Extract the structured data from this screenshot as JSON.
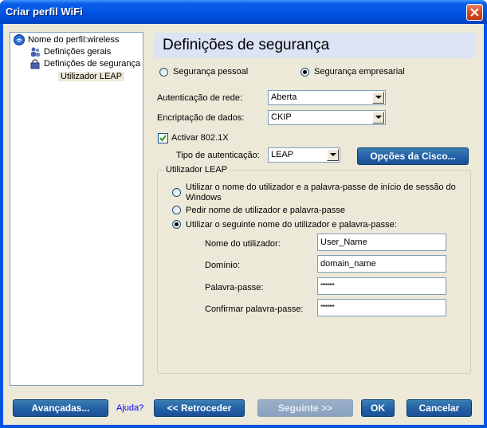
{
  "window": {
    "title": "Criar perfil WiFi"
  },
  "tree": {
    "root": "Nome do perfil:wireless",
    "items": [
      {
        "label": "Definições gerais"
      },
      {
        "label": "Definições de segurança"
      },
      {
        "label": "Utilizador LEAP"
      }
    ]
  },
  "header": {
    "title": "Definições de segurança"
  },
  "security_mode": {
    "personal_label": "Segurança pessoal",
    "enterprise_label": "Segurança empresarial",
    "selected": "enterprise"
  },
  "network_auth": {
    "label": "Autenticação de rede:",
    "value": "Aberta"
  },
  "data_encryption": {
    "label": "Encriptação de dados:",
    "value": "CKIP"
  },
  "enable_8021x": {
    "label": "Activar 802.1X",
    "checked": true
  },
  "auth_type": {
    "label": "Tipo de autenticação:",
    "value": "LEAP"
  },
  "cisco_button": {
    "label": "Opções da Cisco..."
  },
  "leap_group": {
    "title": "Utilizador LEAP",
    "option1_line1": "Utilizar o nome do utilizador e a palavra-passe de início de sessão do",
    "option1_line2": "Windows",
    "option2": "Pedir nome de utilizador e palavra-passe",
    "option3": "Utilizar o seguinte nome do utilizador e palavra-passe:",
    "selected": "option3",
    "fields": {
      "username_label": "Nome do utilizador:",
      "username_value": "User_Name",
      "domain_label": "Domínio:",
      "domain_value": "domain_name",
      "password_label": "Palavra-passe:",
      "password_value": "********",
      "confirm_label": "Confirmar palavra-passe:",
      "confirm_value": "********"
    }
  },
  "footer": {
    "advanced": "Avançadas...",
    "help": "Ajuda?",
    "back": "<< Retroceder",
    "next": "Seguinte >>",
    "ok": "OK",
    "cancel": "Cancelar"
  }
}
